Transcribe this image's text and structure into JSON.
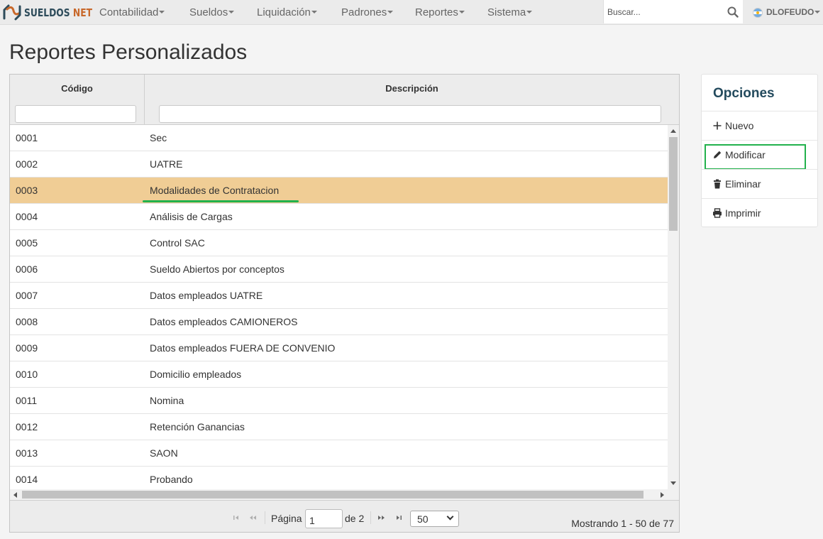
{
  "app": {
    "logo_text_1": "SUELDOS",
    "logo_text_2": "NET",
    "colors": {
      "brand_dark": "#2d4b5a",
      "brand_accent": "#c8682a",
      "selected_row": "#f0cd95",
      "highlight": "#22b14c"
    }
  },
  "nav": {
    "items": [
      "Contabilidad",
      "Sueldos",
      "Liquidación",
      "Padrones",
      "Reportes",
      "Sistema"
    ],
    "search_placeholder": "Buscar...",
    "user": "DLOFEUDO"
  },
  "page": {
    "title": "Reportes Personalizados"
  },
  "grid": {
    "columns": [
      "Código",
      "Descripción"
    ],
    "filter_values": [
      "",
      ""
    ],
    "rows": [
      {
        "code": "0001",
        "desc": "Sec"
      },
      {
        "code": "0002",
        "desc": "UATRE"
      },
      {
        "code": "0003",
        "desc": "Modalidades de Contratacion"
      },
      {
        "code": "0004",
        "desc": "Análisis de Cargas"
      },
      {
        "code": "0005",
        "desc": "Control SAC"
      },
      {
        "code": "0006",
        "desc": "Sueldo Abiertos por conceptos"
      },
      {
        "code": "0007",
        "desc": "Datos empleados UATRE"
      },
      {
        "code": "0008",
        "desc": "Datos empleados CAMIONEROS"
      },
      {
        "code": "0009",
        "desc": "Datos empleados FUERA DE CONVENIO"
      },
      {
        "code": "0010",
        "desc": "Domicilio empleados"
      },
      {
        "code": "0011",
        "desc": "Nomina"
      },
      {
        "code": "0012",
        "desc": "Retención Ganancias"
      },
      {
        "code": "0013",
        "desc": "SAON"
      },
      {
        "code": "0014",
        "desc": "Probando"
      }
    ],
    "selected_code": "0003"
  },
  "pager": {
    "page_label": "Página",
    "page_value": "1",
    "of_label": "de 2",
    "page_size": "50",
    "info": "Mostrando 1 - 50 de 77"
  },
  "options": {
    "title": "Opciones",
    "items": [
      {
        "label": "Nuevo",
        "icon": "plus-icon"
      },
      {
        "label": "Modificar",
        "icon": "pencil-icon"
      },
      {
        "label": "Eliminar",
        "icon": "trash-icon"
      },
      {
        "label": "Imprimir",
        "icon": "printer-icon"
      }
    ]
  }
}
